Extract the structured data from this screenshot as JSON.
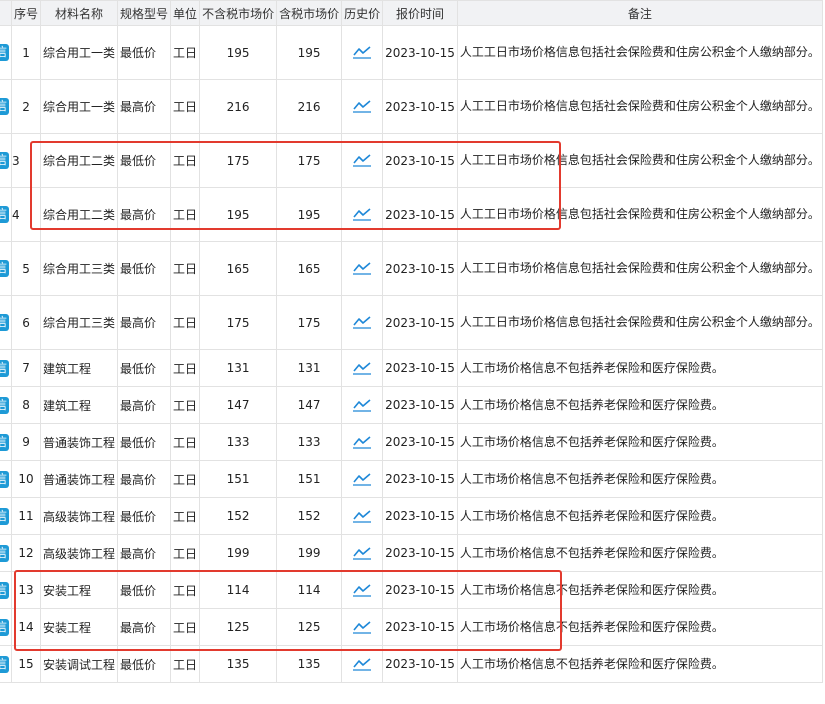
{
  "columns": {
    "badge": "",
    "seq": "序号",
    "name": "材料名称",
    "spec": "规格型号",
    "unit": "单位",
    "price_ex_tax": "不含税市场价",
    "price_in_tax": "含税市场价",
    "history": "历史价",
    "date": "报价时间",
    "note": "备注"
  },
  "badge_label": "信",
  "history_icon": "line-chart-icon",
  "colors": {
    "badge": "#1e9ad6",
    "icon": "#1e88d8",
    "highlight": "#e23a2e",
    "header_bg": "#f1f2f4"
  },
  "rows": [
    {
      "seq": "1",
      "name": "综合用工一类",
      "spec": "最低价",
      "unit": "工日",
      "price_ex_tax": "195",
      "price_in_tax": "195",
      "date": "2023-10-15",
      "note": "人工工日市场价格信息包括社会保险费和住房公积金个人缴纳部分。"
    },
    {
      "seq": "2",
      "name": "综合用工一类",
      "spec": "最高价",
      "unit": "工日",
      "price_ex_tax": "216",
      "price_in_tax": "216",
      "date": "2023-10-15",
      "note": "人工工日市场价格信息包括社会保险费和住房公积金个人缴纳部分。"
    },
    {
      "seq": "3",
      "name": "综合用工二类",
      "spec": "最低价",
      "unit": "工日",
      "price_ex_tax": "175",
      "price_in_tax": "175",
      "date": "2023-10-15",
      "note": "人工工日市场价格信息包括社会保险费和住房公积金个人缴纳部分。"
    },
    {
      "seq": "4",
      "name": "综合用工二类",
      "spec": "最高价",
      "unit": "工日",
      "price_ex_tax": "195",
      "price_in_tax": "195",
      "date": "2023-10-15",
      "note": "人工工日市场价格信息包括社会保险费和住房公积金个人缴纳部分。"
    },
    {
      "seq": "5",
      "name": "综合用工三类",
      "spec": "最低价",
      "unit": "工日",
      "price_ex_tax": "165",
      "price_in_tax": "165",
      "date": "2023-10-15",
      "note": "人工工日市场价格信息包括社会保险费和住房公积金个人缴纳部分。"
    },
    {
      "seq": "6",
      "name": "综合用工三类",
      "spec": "最高价",
      "unit": "工日",
      "price_ex_tax": "175",
      "price_in_tax": "175",
      "date": "2023-10-15",
      "note": "人工工日市场价格信息包括社会保险费和住房公积金个人缴纳部分。"
    },
    {
      "seq": "7",
      "name": "建筑工程",
      "spec": "最低价",
      "unit": "工日",
      "price_ex_tax": "131",
      "price_in_tax": "131",
      "date": "2023-10-15",
      "note": "人工市场价格信息不包括养老保险和医疗保险费。"
    },
    {
      "seq": "8",
      "name": "建筑工程",
      "spec": "最高价",
      "unit": "工日",
      "price_ex_tax": "147",
      "price_in_tax": "147",
      "date": "2023-10-15",
      "note": "人工市场价格信息不包括养老保险和医疗保险费。"
    },
    {
      "seq": "9",
      "name": "普通装饰工程",
      "spec": "最低价",
      "unit": "工日",
      "price_ex_tax": "133",
      "price_in_tax": "133",
      "date": "2023-10-15",
      "note": "人工市场价格信息不包括养老保险和医疗保险费。"
    },
    {
      "seq": "10",
      "name": "普通装饰工程",
      "spec": "最高价",
      "unit": "工日",
      "price_ex_tax": "151",
      "price_in_tax": "151",
      "date": "2023-10-15",
      "note": "人工市场价格信息不包括养老保险和医疗保险费。"
    },
    {
      "seq": "11",
      "name": "高级装饰工程",
      "spec": "最低价",
      "unit": "工日",
      "price_ex_tax": "152",
      "price_in_tax": "152",
      "date": "2023-10-15",
      "note": "人工市场价格信息不包括养老保险和医疗保险费。"
    },
    {
      "seq": "12",
      "name": "高级装饰工程",
      "spec": "最高价",
      "unit": "工日",
      "price_ex_tax": "199",
      "price_in_tax": "199",
      "date": "2023-10-15",
      "note": "人工市场价格信息不包括养老保险和医疗保险费。"
    },
    {
      "seq": "13",
      "name": "安装工程",
      "spec": "最低价",
      "unit": "工日",
      "price_ex_tax": "114",
      "price_in_tax": "114",
      "date": "2023-10-15",
      "note": "人工市场价格信息不包括养老保险和医疗保险费。"
    },
    {
      "seq": "14",
      "name": "安装工程",
      "spec": "最高价",
      "unit": "工日",
      "price_ex_tax": "125",
      "price_in_tax": "125",
      "date": "2023-10-15",
      "note": "人工市场价格信息不包括养老保险和医疗保险费。"
    },
    {
      "seq": "15",
      "name": "安装调试工程",
      "spec": "最低价",
      "unit": "工日",
      "price_ex_tax": "135",
      "price_in_tax": "135",
      "date": "2023-10-15",
      "note": "人工市场价格信息不包括养老保险和医疗保险费。"
    }
  ]
}
